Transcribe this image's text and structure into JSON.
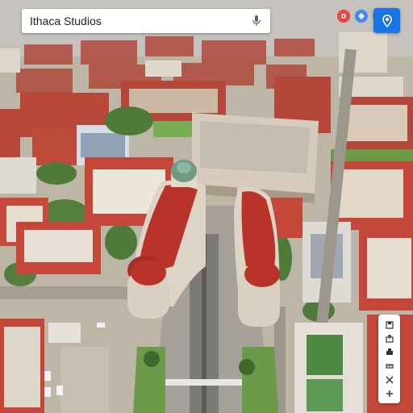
{
  "search": {
    "value": "Ithaca Studios"
  },
  "icons": {
    "mic": "microphone-icon",
    "layers": "layers-icon",
    "directions": "directions-icon",
    "profile": "location-pin-icon",
    "toolbar": [
      "save-icon",
      "share-icon",
      "print-icon",
      "measure-icon",
      "tools-icon",
      "zoom-in-icon"
    ]
  },
  "colors": {
    "accent": "#1a73e8",
    "roof": "#b8342b",
    "dome": "#6f9b84"
  }
}
